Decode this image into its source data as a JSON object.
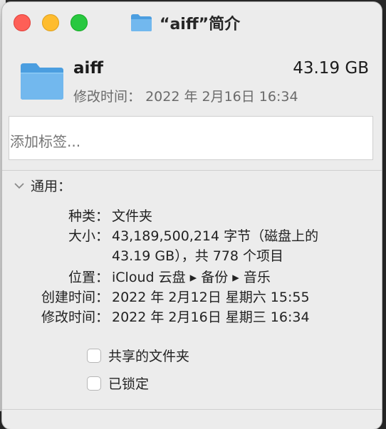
{
  "window": {
    "title": "“aiff”简介"
  },
  "header": {
    "name": "aiff",
    "size": "43.19 GB",
    "modified_label": "修改时间：",
    "modified_value": "2022 年 2月16日 16:34"
  },
  "tags": {
    "placeholder": "添加标签..."
  },
  "general": {
    "label": "通用：",
    "rows": [
      {
        "key": "种类：",
        "value": "文件夹"
      },
      {
        "key": "大小：",
        "value": "43,189,500,214 字节（磁盘上的 43.19 GB），共 778 个项目"
      },
      {
        "key": "位置：",
        "value": "iCloud 云盘 ▸ 备份 ▸ 音乐"
      },
      {
        "key": "创建时间：",
        "value": "2022 年 2月12日 星期六 15:55"
      },
      {
        "key": "修改时间：",
        "value": "2022 年 2月16日 星期三 16:34"
      }
    ],
    "shared_folder_label": "共享的文件夹",
    "locked_label": "已锁定"
  },
  "colors": {
    "window_bg": "#ececec",
    "folder_blue": "#5aa9e6",
    "close": "#fe5f57",
    "minimize": "#febc2e",
    "maximize": "#28c840"
  },
  "icons": [
    "folder-icon",
    "chevron-down-icon"
  ]
}
